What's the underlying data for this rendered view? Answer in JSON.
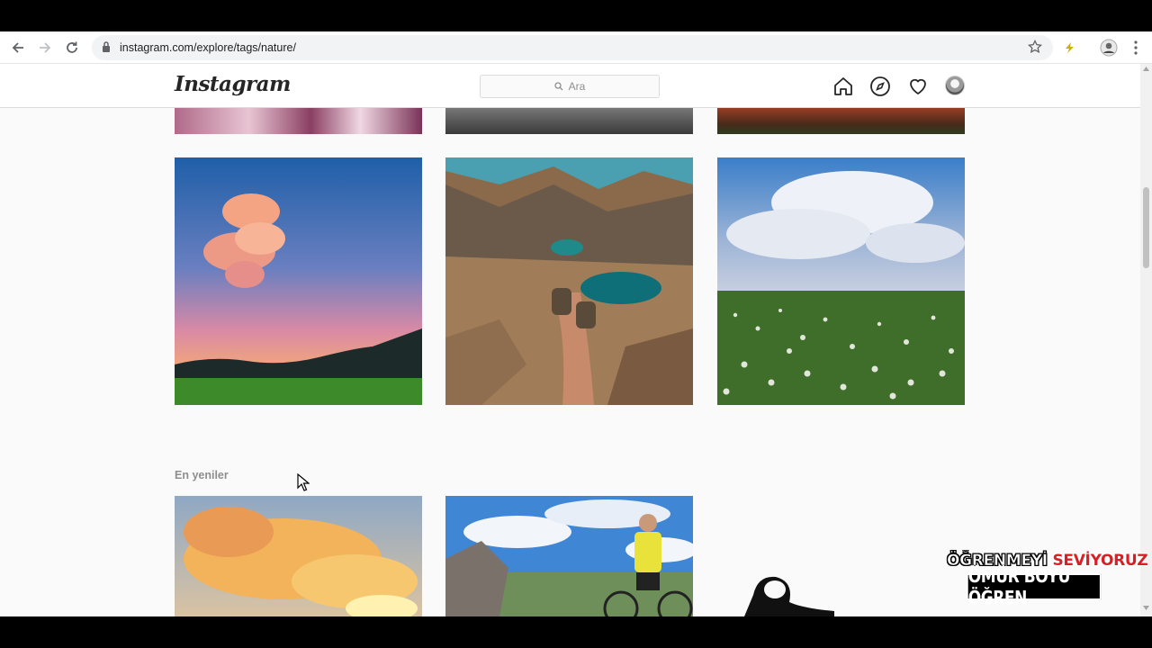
{
  "browser": {
    "url": "instagram.com/explore/tags/nature/"
  },
  "header": {
    "logo": "Instagram",
    "search_placeholder": "Ara"
  },
  "section": {
    "title": "En yeniler"
  },
  "watermark": {
    "line1_part1": "ÖĞRENMEYİ",
    "line1_part2": "SEVİYORUZ",
    "line2": "ÖMÜR BOYU ÖĞREN"
  },
  "colors": {
    "accent_red": "#d81f26",
    "ig_text": "#262626",
    "muted": "#8e8e8e"
  },
  "icons": [
    "back-arrow-icon",
    "forward-arrow-icon",
    "reload-icon",
    "lock-icon",
    "star-icon",
    "extension-icon",
    "profile-icon",
    "menu-dots-icon",
    "search-icon",
    "home-icon",
    "compass-icon",
    "heart-icon"
  ]
}
